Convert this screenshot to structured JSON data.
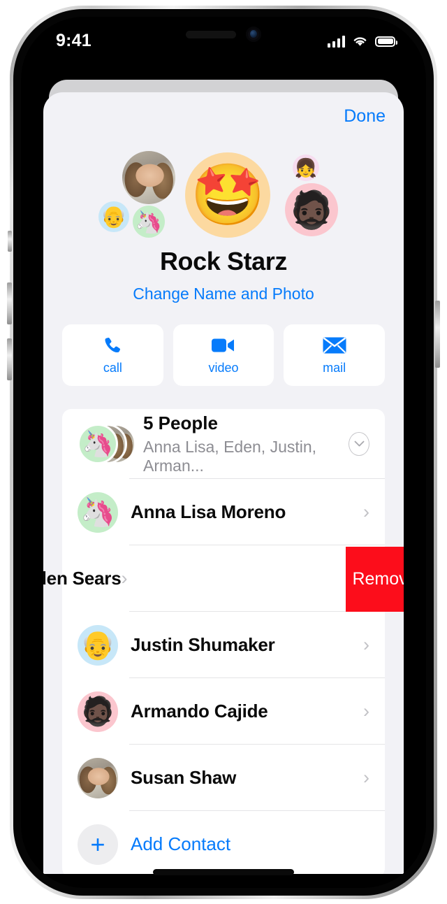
{
  "status_bar": {
    "time": "9:41",
    "signal_icon": "cellular-bars-icon",
    "wifi_icon": "wifi-icon",
    "battery_icon": "battery-icon"
  },
  "header": {
    "done_label": "Done"
  },
  "group": {
    "name": "Rock Starz",
    "change_link": "Change Name and Photo",
    "main_avatar_emoji": "🤩",
    "avatars": [
      {
        "name": "susan-photo-avatar",
        "glyph": ""
      },
      {
        "name": "justin-memoji-avatar",
        "glyph": "👴"
      },
      {
        "name": "annalisa-memoji-avatar",
        "glyph": "🦄"
      },
      {
        "name": "eden-memoji-avatar",
        "glyph": "👧"
      },
      {
        "name": "armando-memoji-avatar",
        "glyph": "🧔🏿"
      }
    ]
  },
  "actions": [
    {
      "label": "call",
      "icon": "phone-icon"
    },
    {
      "label": "video",
      "icon": "video-camera-icon"
    },
    {
      "label": "mail",
      "icon": "envelope-icon"
    }
  ],
  "people_summary": {
    "title": "5 People",
    "names": "Anna Lisa, Eden, Justin, Arman...",
    "expand_icon": "chevron-down-circle-icon"
  },
  "contacts": [
    {
      "name": "Anna Lisa Moreno",
      "avatar_glyph": "🦄",
      "avatar_bg": "green",
      "swiped": false
    },
    {
      "name": "den Sears",
      "avatar_glyph": "👧",
      "avatar_bg": "pinklight",
      "swiped": true,
      "remove_label": "Remove"
    },
    {
      "name": "Justin Shumaker",
      "avatar_glyph": "👴",
      "avatar_bg": "blue",
      "swiped": false
    },
    {
      "name": "Armando Cajide",
      "avatar_glyph": "🧔🏿",
      "avatar_bg": "pink",
      "swiped": false
    },
    {
      "name": "Susan Shaw",
      "avatar_glyph": "",
      "avatar_bg": "photo",
      "swiped": false
    }
  ],
  "add_contact": {
    "label": "Add Contact",
    "icon": "plus-icon"
  },
  "colors": {
    "accent_blue": "#067bfb",
    "destructive_red": "#fc0d1b",
    "sheet_bg": "#f2f2f6",
    "card_bg": "#ffffff",
    "secondary_text": "#8d8d93"
  }
}
